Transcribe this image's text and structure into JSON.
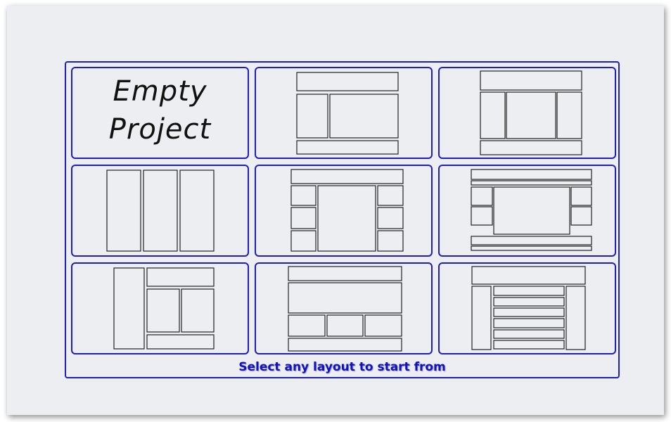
{
  "empty_project": {
    "line1": "Empty",
    "line2": "Project"
  },
  "caption": "Select any layout to start from",
  "colors": {
    "accent": "#1f1fbf",
    "caption": "#1212c0",
    "background": "#eceef2",
    "outline": "#222222"
  },
  "layouts": [
    {
      "name": "empty-project"
    },
    {
      "name": "header-sidebar-content-footer"
    },
    {
      "name": "header-three-columns-footer"
    },
    {
      "name": "three-columns"
    },
    {
      "name": "header-content-with-side-boxes"
    },
    {
      "name": "double-header-content-side-boxes-double-footer"
    },
    {
      "name": "sidebar-header-two-columns-footer"
    },
    {
      "name": "header-banner-three-boxes-footer"
    },
    {
      "name": "header-two-sidebars-stacked-rows"
    }
  ]
}
